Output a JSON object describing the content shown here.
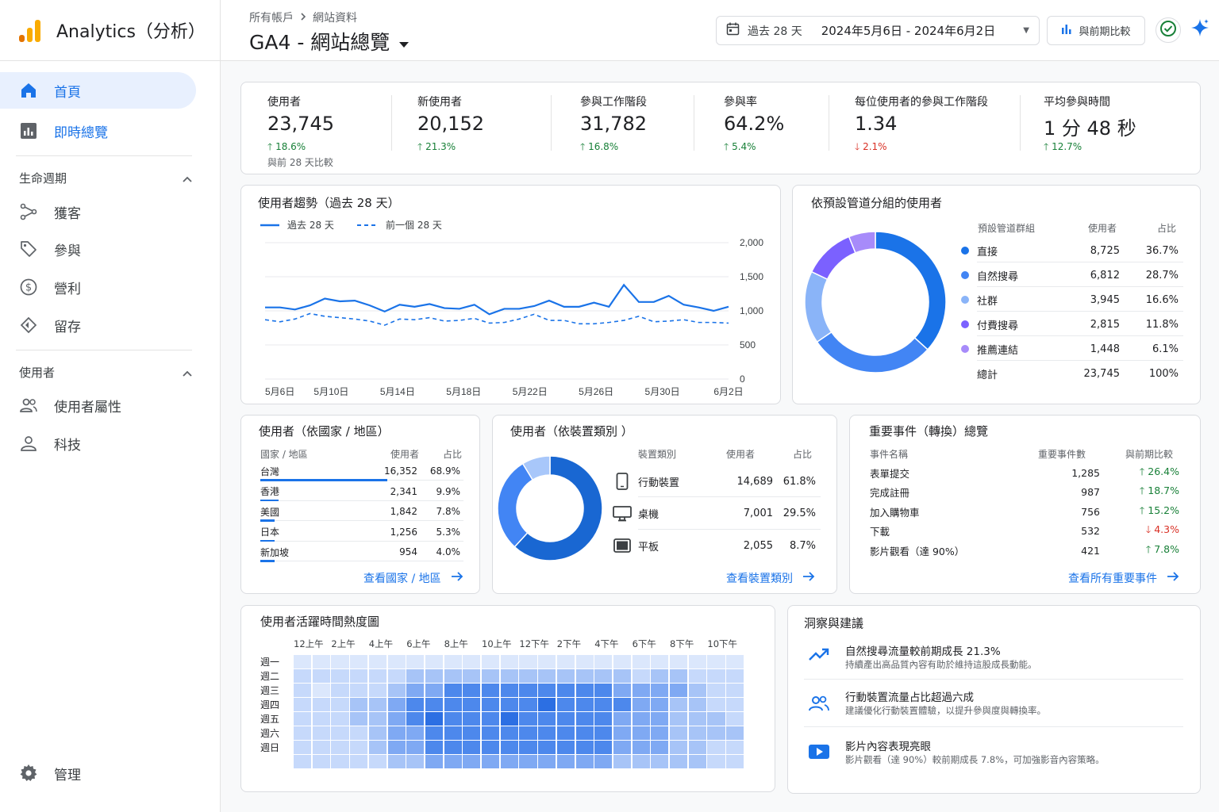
{
  "app": {
    "title": "Analytics（分析）"
  },
  "colors": {
    "accent": "#1a73e8",
    "up": "#188038",
    "down": "#d93025",
    "logo_orange": "#f9ab00",
    "logo_dark": "#e37400"
  },
  "sidebar": {
    "home": "首頁",
    "realtime": "即時總覽",
    "lifecycle": {
      "title": "生命週期",
      "items": [
        "獲客",
        "參與",
        "營利",
        "留存"
      ]
    },
    "user": {
      "title": "使用者",
      "items": [
        "使用者屬性",
        "科技"
      ]
    },
    "admin": "管理"
  },
  "header": {
    "breadcrumb": [
      "所有帳戶",
      "網站資料"
    ],
    "title": "GA4 - 網站總覽",
    "date_preset": "過去 28 天",
    "date_range": "2024年5月6日 - 2024年6月2日",
    "compare_label": "與前期比較"
  },
  "kpis": [
    {
      "label": "使用者",
      "value": "23,745",
      "delta": "18.6%",
      "dir": "up",
      "note": "與前 28 天比較"
    },
    {
      "label": "新使用者",
      "value": "20,152",
      "delta": "21.3%",
      "dir": "up"
    },
    {
      "label": "參與工作階段",
      "value": "31,782",
      "delta": "16.8%",
      "dir": "up"
    },
    {
      "label": "參與率",
      "value": "64.2%",
      "delta": "5.4%",
      "dir": "up"
    },
    {
      "label": "每位使用者的參與工作階段",
      "value": "1.34",
      "delta": "2.1%",
      "dir": "down"
    },
    {
      "label": "平均參與時間",
      "value": "1 分 48 秒",
      "delta": "12.7%",
      "dir": "up"
    }
  ],
  "trend": {
    "title": "使用者趨勢（過去 28 天）",
    "legend_current": "過去 28 天",
    "legend_previous": "前一個 28 天",
    "chart_data": {
      "type": "line",
      "title": "使用者趨勢（過去 28 天）",
      "x_labels": [
        "5月6日",
        "5月10日",
        "5月14日",
        "5月18日",
        "5月22日",
        "5月26日",
        "5月30日",
        "6月2日"
      ],
      "y_ticks": [
        "2,000",
        "1,500",
        "1,000",
        "500",
        "0"
      ],
      "ylim": [
        0,
        2000
      ],
      "series": [
        {
          "name": "過去 28 天",
          "style": "solid",
          "values": [
            1050,
            1050,
            1020,
            1080,
            1180,
            1140,
            1150,
            1080,
            990,
            1090,
            1060,
            1100,
            1040,
            1030,
            1090,
            950,
            1030,
            1030,
            1070,
            1150,
            1060,
            1060,
            1120,
            1060,
            1380,
            1130,
            1130,
            1220,
            1090,
            1050,
            1000,
            1060
          ]
        },
        {
          "name": "前一個 28 天",
          "style": "dashed",
          "values": [
            870,
            840,
            880,
            960,
            920,
            900,
            880,
            850,
            790,
            880,
            870,
            900,
            850,
            860,
            890,
            820,
            830,
            880,
            950,
            860,
            860,
            810,
            810,
            830,
            860,
            920,
            840,
            850,
            870,
            830,
            830,
            820
          ]
        }
      ]
    }
  },
  "channels": {
    "title": "依預設管道分組的使用者",
    "headers": [
      "預設管道群組",
      "使用者",
      "占比"
    ],
    "rows": [
      {
        "name": "直接",
        "users": "8,725",
        "pct": "36.7%",
        "color": "#1a73e8"
      },
      {
        "name": "自然搜尋",
        "users": "6,812",
        "pct": "28.7%",
        "color": "#4285f4"
      },
      {
        "name": "社群",
        "users": "3,945",
        "pct": "16.6%",
        "color": "#8ab4f8"
      },
      {
        "name": "付費搜尋",
        "users": "2,815",
        "pct": "11.8%",
        "color": "#7b61ff"
      },
      {
        "name": "推薦連結",
        "users": "1,448",
        "pct": "6.1%",
        "color": "#a78bfa"
      }
    ],
    "total": {
      "name": "總計",
      "users": "23,745",
      "pct": "100%"
    },
    "chart_data": {
      "type": "pie",
      "labels": [
        "直接",
        "自然搜尋",
        "社群",
        "付費搜尋",
        "推薦連結"
      ],
      "values": [
        36.7,
        28.7,
        16.6,
        11.8,
        6.1
      ]
    }
  },
  "countries": {
    "title": "使用者（依國家 / 地區）",
    "headers": [
      "國家 / 地區",
      "使用者",
      "占比"
    ],
    "rows": [
      {
        "name": "台灣",
        "users": "16,352",
        "pct": "68.9%",
        "frac": 0.689
      },
      {
        "name": "香港",
        "users": "2,341",
        "pct": "9.9%",
        "frac": 0.099
      },
      {
        "name": "美國",
        "users": "1,842",
        "pct": "7.8%",
        "frac": 0.078
      },
      {
        "name": "日本",
        "users": "1,256",
        "pct": "5.3%",
        "frac": 0.053
      },
      {
        "name": "新加坡",
        "users": "954",
        "pct": "4.0%",
        "frac": 0.04
      }
    ],
    "link": "查看國家 / 地區"
  },
  "devices": {
    "title": "使用者（依裝置類別 ）",
    "headers": [
      "裝置類別",
      "使用者",
      "占比"
    ],
    "rows": [
      {
        "name": "行動裝置",
        "users": "14,689",
        "pct": "61.8%",
        "icon": "phone-icon"
      },
      {
        "name": "桌機",
        "users": "7,001",
        "pct": "29.5%",
        "icon": "desktop-icon"
      },
      {
        "name": "平板",
        "users": "2,055",
        "pct": "8.7%",
        "icon": "tablet-icon"
      }
    ],
    "link": "查看裝置類別",
    "chart_data": {
      "type": "pie",
      "labels": [
        "行動裝置",
        "桌機",
        "平板"
      ],
      "values": [
        61.8,
        29.5,
        8.7
      ]
    }
  },
  "events": {
    "title": "重要事件（轉換）總覽",
    "headers": [
      "事件名稱",
      "重要事件數",
      "與前期比較"
    ],
    "rows": [
      {
        "name": "表單提交",
        "count": "1,285",
        "delta": "26.4%",
        "dir": "up"
      },
      {
        "name": "完成註冊",
        "count": "987",
        "delta": "18.7%",
        "dir": "up"
      },
      {
        "name": "加入購物車",
        "count": "756",
        "delta": "15.2%",
        "dir": "up"
      },
      {
        "name": "下載",
        "count": "532",
        "delta": "4.3%",
        "dir": "down"
      },
      {
        "name": "影片觀看（達 90%）",
        "count": "421",
        "delta": "7.8%",
        "dir": "up"
      }
    ],
    "link": "查看所有重要事件"
  },
  "heatmap": {
    "title": "使用者活躍時間熱度圖",
    "hours": [
      "12上午",
      "2上午",
      "4上午",
      "6上午",
      "8上午",
      "10上午",
      "12下午",
      "2下午",
      "4下午",
      "6下午",
      "8下午",
      "10下午"
    ],
    "days": [
      "週一",
      "週二",
      "週三",
      "週四",
      "週五",
      "週六",
      "週日"
    ],
    "chart_data": {
      "type": "heatmap",
      "columns": 24,
      "rows": [
        [
          1,
          1,
          1,
          1,
          1,
          1,
          1,
          1,
          1,
          1,
          1,
          1,
          1,
          1,
          1,
          1,
          1,
          1,
          1,
          1,
          1,
          1,
          1,
          1
        ],
        [
          2,
          2,
          2,
          2,
          2,
          2,
          3,
          3,
          3,
          3,
          3,
          3,
          3,
          3,
          3,
          3,
          3,
          3,
          2,
          3,
          3,
          2,
          2,
          2
        ],
        [
          2,
          1,
          2,
          2,
          2,
          3,
          4,
          4,
          5,
          5,
          5,
          5,
          5,
          5,
          5,
          5,
          5,
          4,
          4,
          4,
          4,
          3,
          2,
          2
        ],
        [
          2,
          2,
          2,
          3,
          3,
          4,
          5,
          5,
          5,
          5,
          5,
          5,
          5,
          6,
          5,
          5,
          5,
          5,
          4,
          4,
          3,
          3,
          2,
          2
        ],
        [
          2,
          2,
          2,
          3,
          3,
          4,
          5,
          6,
          5,
          5,
          5,
          6,
          5,
          5,
          5,
          5,
          5,
          4,
          4,
          4,
          3,
          3,
          3,
          2
        ],
        [
          2,
          2,
          2,
          2,
          3,
          4,
          4,
          5,
          5,
          5,
          5,
          5,
          5,
          5,
          5,
          5,
          5,
          4,
          4,
          4,
          3,
          3,
          3,
          3
        ],
        [
          2,
          2,
          2,
          2,
          3,
          4,
          4,
          5,
          5,
          5,
          5,
          5,
          5,
          5,
          5,
          5,
          5,
          4,
          4,
          4,
          3,
          3,
          2,
          2
        ],
        [
          2,
          2,
          2,
          2,
          2,
          3,
          3,
          4,
          4,
          4,
          4,
          4,
          4,
          4,
          4,
          4,
          4,
          3,
          3,
          3,
          3,
          3,
          2,
          2
        ]
      ]
    }
  },
  "insights": {
    "title": "洞察與建議",
    "items": [
      {
        "title": "自然搜尋流量較前期成長 21.3%",
        "desc": "持續產出高品質內容有助於維持這股成長動能。",
        "icon": "trending-up-icon"
      },
      {
        "title": "行動裝置流量占比超過六成",
        "desc": "建議優化行動裝置體驗，以提升參與度與轉換率。",
        "icon": "users-icon"
      },
      {
        "title": "影片內容表現亮眼",
        "desc": "影片觀看（達 90%）較前期成長 7.8%，可加強影音內容策略。",
        "icon": "video-icon"
      }
    ]
  }
}
